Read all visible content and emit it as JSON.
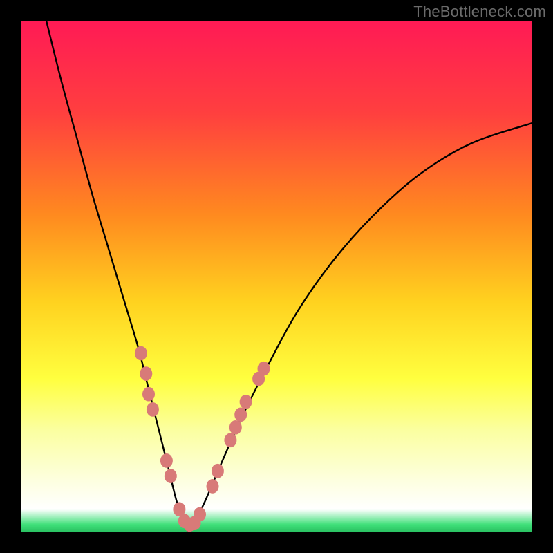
{
  "watermark": "TheBottleneck.com",
  "chart_data": {
    "type": "line",
    "title": "",
    "xlabel": "",
    "ylabel": "",
    "xlim": [
      0,
      100
    ],
    "ylim": [
      0,
      100
    ],
    "gradient_stops": [
      {
        "offset": 0.0,
        "color": "#ff1a55"
      },
      {
        "offset": 0.18,
        "color": "#ff3f3f"
      },
      {
        "offset": 0.38,
        "color": "#ff8a1f"
      },
      {
        "offset": 0.55,
        "color": "#ffd21f"
      },
      {
        "offset": 0.7,
        "color": "#ffff3f"
      },
      {
        "offset": 0.8,
        "color": "#fbffa0"
      },
      {
        "offset": 0.9,
        "color": "#fdffe0"
      },
      {
        "offset": 0.955,
        "color": "#ffffff"
      },
      {
        "offset": 0.985,
        "color": "#40e07a"
      },
      {
        "offset": 1.0,
        "color": "#28c060"
      }
    ],
    "series": [
      {
        "name": "bottleneck-curve",
        "note": "V-shaped curve; y represents bottleneck % (100 = worst at top, 0 = best at bottom)",
        "x": [
          5,
          8,
          11,
          14,
          17,
          20,
          23,
          25,
          27,
          29,
          30.5,
          32,
          33,
          34,
          36,
          39,
          43,
          48,
          54,
          61,
          69,
          78,
          88,
          100
        ],
        "y": [
          100,
          88,
          77,
          66,
          56,
          46,
          36,
          28,
          20,
          12,
          6,
          2,
          0,
          2,
          6,
          13,
          22,
          32,
          43,
          53,
          62,
          70,
          76,
          80
        ]
      }
    ],
    "markers": {
      "name": "highlight-dots",
      "color": "#d87a78",
      "radius": 9,
      "points": [
        {
          "x": 23.5,
          "y": 35
        },
        {
          "x": 24.5,
          "y": 31
        },
        {
          "x": 25.0,
          "y": 27
        },
        {
          "x": 25.8,
          "y": 24
        },
        {
          "x": 28.5,
          "y": 14
        },
        {
          "x": 29.3,
          "y": 11
        },
        {
          "x": 31.0,
          "y": 4.5
        },
        {
          "x": 32.0,
          "y": 2.2
        },
        {
          "x": 33.0,
          "y": 1.5
        },
        {
          "x": 34.0,
          "y": 1.8
        },
        {
          "x": 35.0,
          "y": 3.5
        },
        {
          "x": 37.5,
          "y": 9
        },
        {
          "x": 38.5,
          "y": 12
        },
        {
          "x": 41.0,
          "y": 18
        },
        {
          "x": 42.0,
          "y": 20.5
        },
        {
          "x": 43.0,
          "y": 23
        },
        {
          "x": 44.0,
          "y": 25.5
        },
        {
          "x": 46.5,
          "y": 30
        },
        {
          "x": 47.5,
          "y": 32
        }
      ]
    }
  }
}
